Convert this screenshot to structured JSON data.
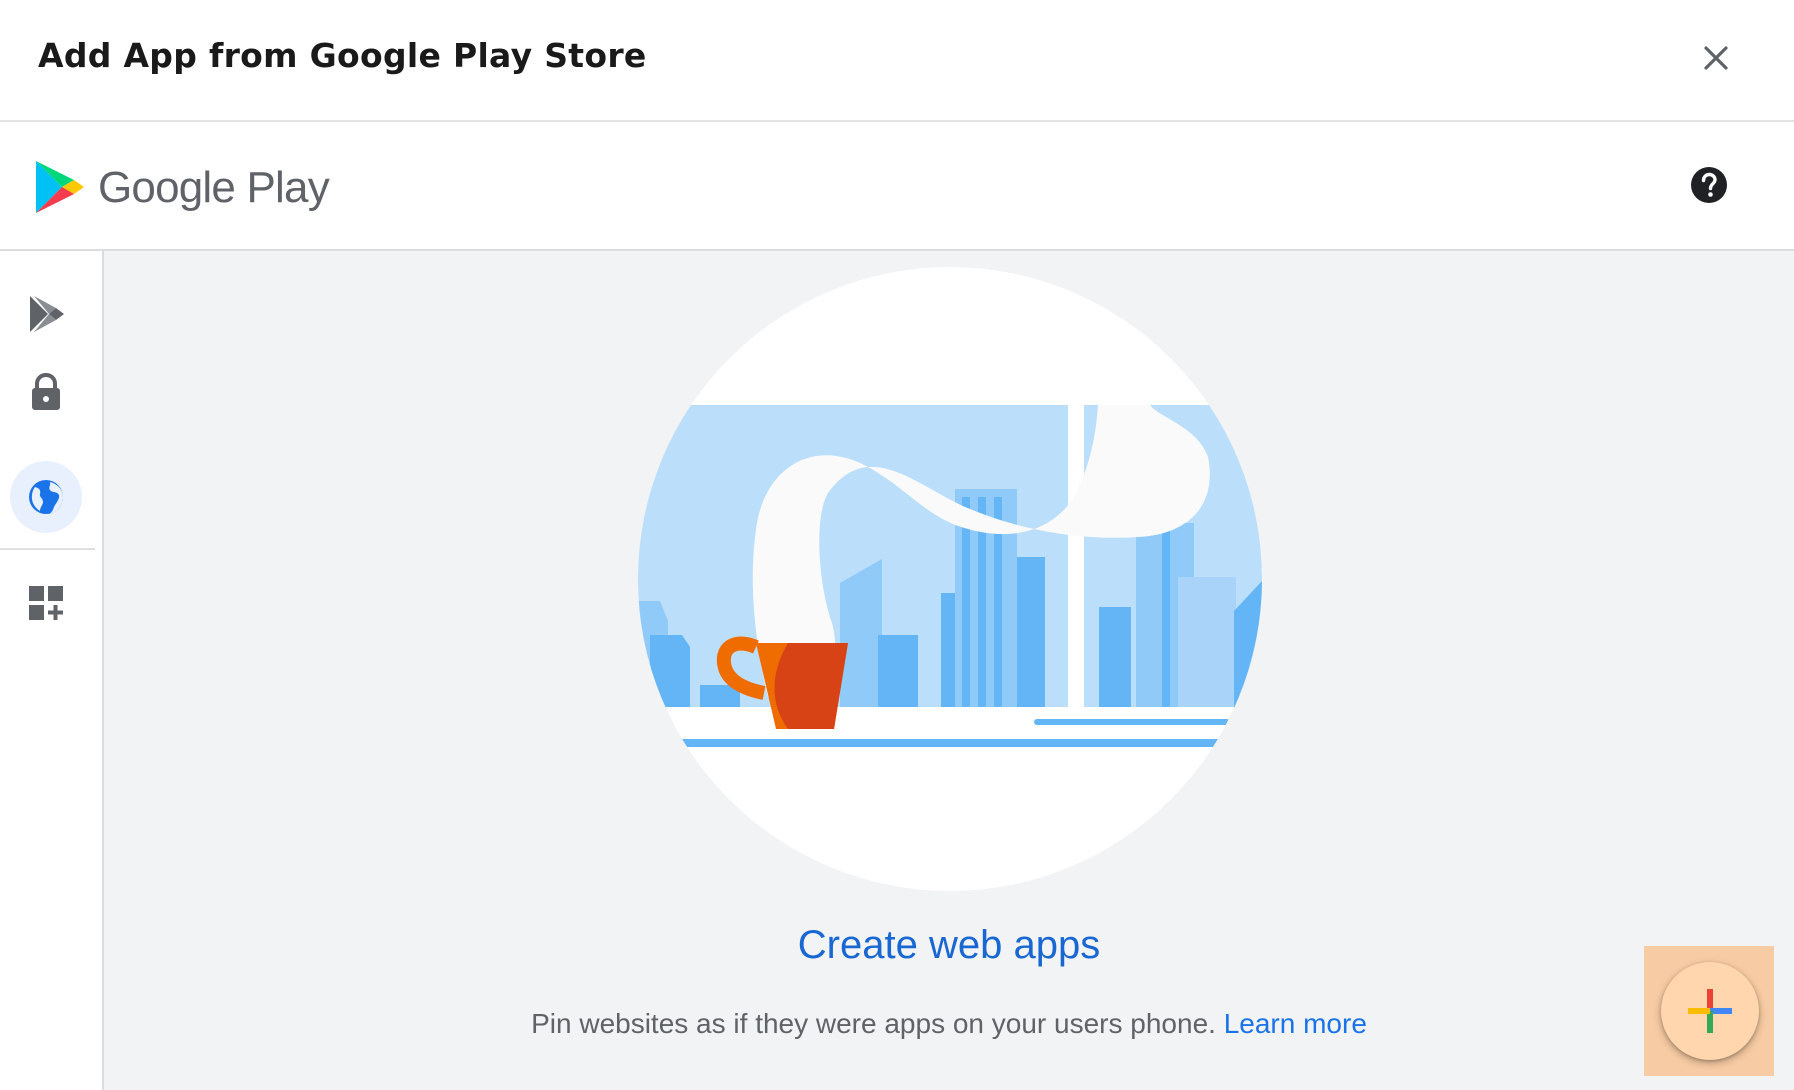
{
  "dialog": {
    "title": "Add App from Google Play Store"
  },
  "play_header": {
    "wordmark": "Google Play",
    "logo_icon": "google-play-logo-icon",
    "help_icon": "help-circle-icon"
  },
  "sidebar": {
    "items": [
      {
        "name": "play-store",
        "icon": "play-store-icon",
        "active": false
      },
      {
        "name": "private-apps",
        "icon": "lock-icon",
        "active": false
      },
      {
        "name": "web-apps",
        "icon": "globe-icon",
        "active": true
      },
      {
        "name": "organize-apps",
        "icon": "grid-add-icon",
        "active": false
      }
    ]
  },
  "main": {
    "empty_title": "Create web apps",
    "empty_description": "Pin websites as if they were apps on your users phone.",
    "learn_more": "Learn more"
  },
  "fab": {
    "icon": "google-plus-icon"
  },
  "colors": {
    "accent_blue": "#1a73e8",
    "title_blue": "#1967d2",
    "canvas_gray": "#f1f3f4",
    "active_nav_bg": "#e8f0fe",
    "highlight": "#f7cba3"
  }
}
